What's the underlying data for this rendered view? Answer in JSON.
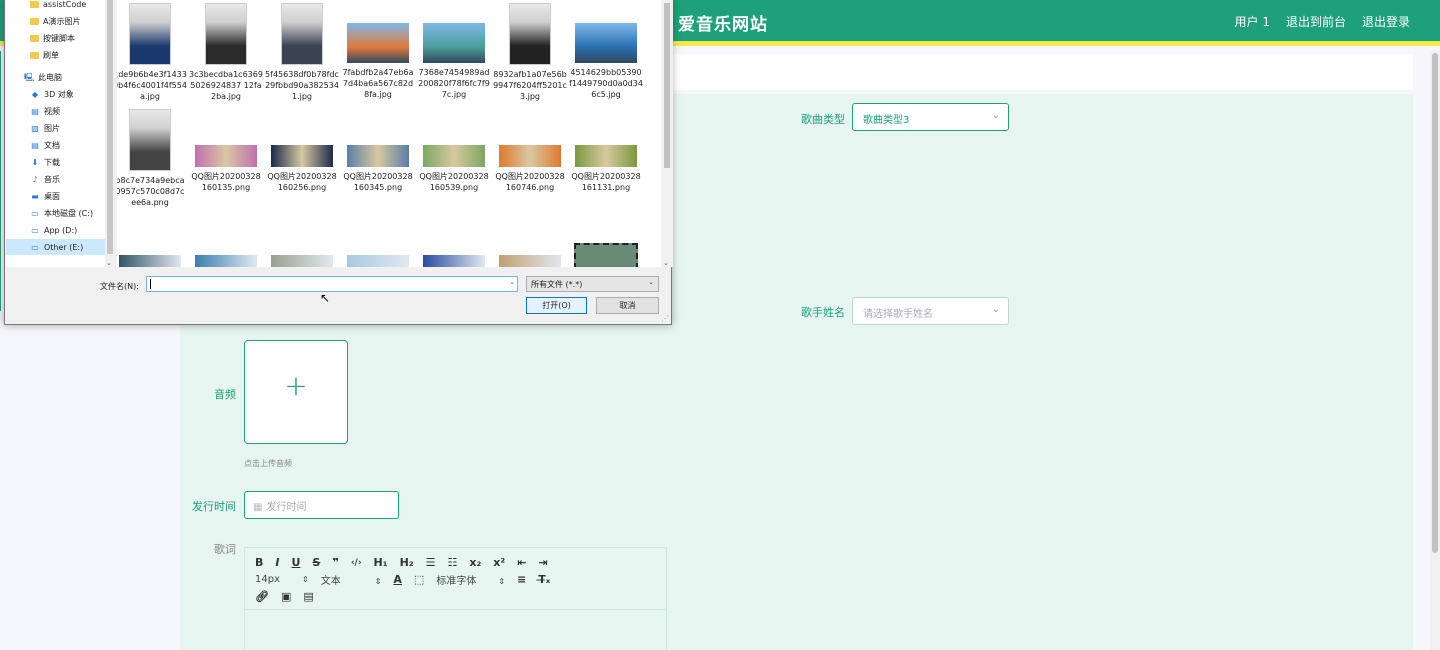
{
  "app": {
    "title": "爱音乐网站",
    "header_links": [
      "用户 1",
      "退出到前台",
      "退出登录"
    ],
    "brand_color": "#1ea07a",
    "accent_line_color": "#f5e84a"
  },
  "form": {
    "song_type": {
      "label": "歌曲类型",
      "value": "歌曲类型3"
    },
    "singer": {
      "label": "歌手姓名",
      "placeholder": "请选择歌手姓名"
    },
    "audio": {
      "label": "音频",
      "hint": "点击上传音频",
      "icon": "plus-icon"
    },
    "release_time": {
      "label": "发行时间",
      "placeholder": "发行时间",
      "icon": "calendar-icon"
    },
    "lyrics": {
      "label": "歌词",
      "toolbar_row1": [
        "B",
        "I",
        "U",
        "S",
        "❞",
        "</>",
        "H1",
        "H2",
        "ol",
        "ul",
        "x₂",
        "x²",
        "outdent",
        "indent"
      ],
      "font_size": "14px",
      "header_select": "文本",
      "font_family": "标准字体"
    }
  },
  "dialog": {
    "nav_items": [
      {
        "label": "assistCode",
        "icon": "folder-icon"
      },
      {
        "label": "A演示图片",
        "icon": "folder-icon"
      },
      {
        "label": "按键脚本",
        "icon": "folder-icon"
      },
      {
        "label": "刷单",
        "icon": "folder-icon"
      },
      {
        "label": "此电脑",
        "icon": "computer-icon"
      },
      {
        "label": "3D 对象",
        "icon": "3d-objects-icon"
      },
      {
        "label": "视频",
        "icon": "video-icon"
      },
      {
        "label": "图片",
        "icon": "pictures-icon"
      },
      {
        "label": "文档",
        "icon": "documents-icon"
      },
      {
        "label": "下载",
        "icon": "download-icon"
      },
      {
        "label": "音乐",
        "icon": "music-icon"
      },
      {
        "label": "桌面",
        "icon": "desktop-icon"
      },
      {
        "label": "本地磁盘 (C:)",
        "icon": "drive-icon"
      },
      {
        "label": "App (D:)",
        "icon": "drive-icon"
      },
      {
        "label": "Other (E:)",
        "icon": "drive-icon"
      }
    ],
    "files": [
      {
        "name": "1de9b6b4e3f14330b4f6c4001f4f554a.jpg",
        "kind": "portrait",
        "color": "#1a3a6e"
      },
      {
        "name": "3c3becdba1c63695026924837 12fa2ba.jpg",
        "kind": "portrait",
        "color": "#2a2a2a"
      },
      {
        "name": "5f45638df0b78fdc29fbbd90a3825341.jpg",
        "kind": "portrait",
        "color": "#3b4452"
      },
      {
        "name": "7fabdfb2a47eb6a7d4ba6a567c82d8fa.jpg",
        "kind": "landscape",
        "color": "#e0793a"
      },
      {
        "name": "7368e7454989ad200820f78f6fc7f97c.jpg",
        "kind": "landscape",
        "color": "#4a9e9a"
      },
      {
        "name": "8932afb1a07e56b9947f6204ff5201c3.jpg",
        "kind": "portrait",
        "color": "#222"
      },
      {
        "name": "4514629bb05390f1449790d0a0d346c5.jpg",
        "kind": "landscape",
        "color": "#2a6fb0"
      },
      {
        "name": "b8c7e734a9ebca0957c570c08d7cee6a.png",
        "kind": "portrait",
        "color": "#444"
      },
      {
        "name": "QQ图片20200328160135.png",
        "kind": "banner",
        "color": "#c070b0"
      },
      {
        "name": "QQ图片20200328160256.png",
        "kind": "banner",
        "color": "#1b2a4a"
      },
      {
        "name": "QQ图片20200328160345.png",
        "kind": "banner",
        "color": "#5a7fa8"
      },
      {
        "name": "QQ图片20200328160539.png",
        "kind": "banner",
        "color": "#7aa860"
      },
      {
        "name": "QQ图片20200328160746.png",
        "kind": "banner",
        "color": "#e07a30"
      },
      {
        "name": "QQ图片20200328161131.png",
        "kind": "banner",
        "color": "#7a9a40"
      },
      {
        "name": "",
        "kind": "partial",
        "color": "#335566"
      },
      {
        "name": "",
        "kind": "partial",
        "color": "#3a80b0"
      },
      {
        "name": "",
        "kind": "partial",
        "color": "#9aa090"
      },
      {
        "name": "",
        "kind": "partial",
        "color": "#a8c8e0"
      },
      {
        "name": "",
        "kind": "partial",
        "color": "#2a4aa0"
      },
      {
        "name": "",
        "kind": "partial",
        "color": "#c0a070"
      },
      {
        "name": "",
        "kind": "video",
        "color": "#6a8a78"
      }
    ],
    "filename_label": "文件名(N):",
    "filename_value": "",
    "filetype_value": "所有文件 (*.*)",
    "open_button": "打开(O)",
    "cancel_button": "取消"
  }
}
